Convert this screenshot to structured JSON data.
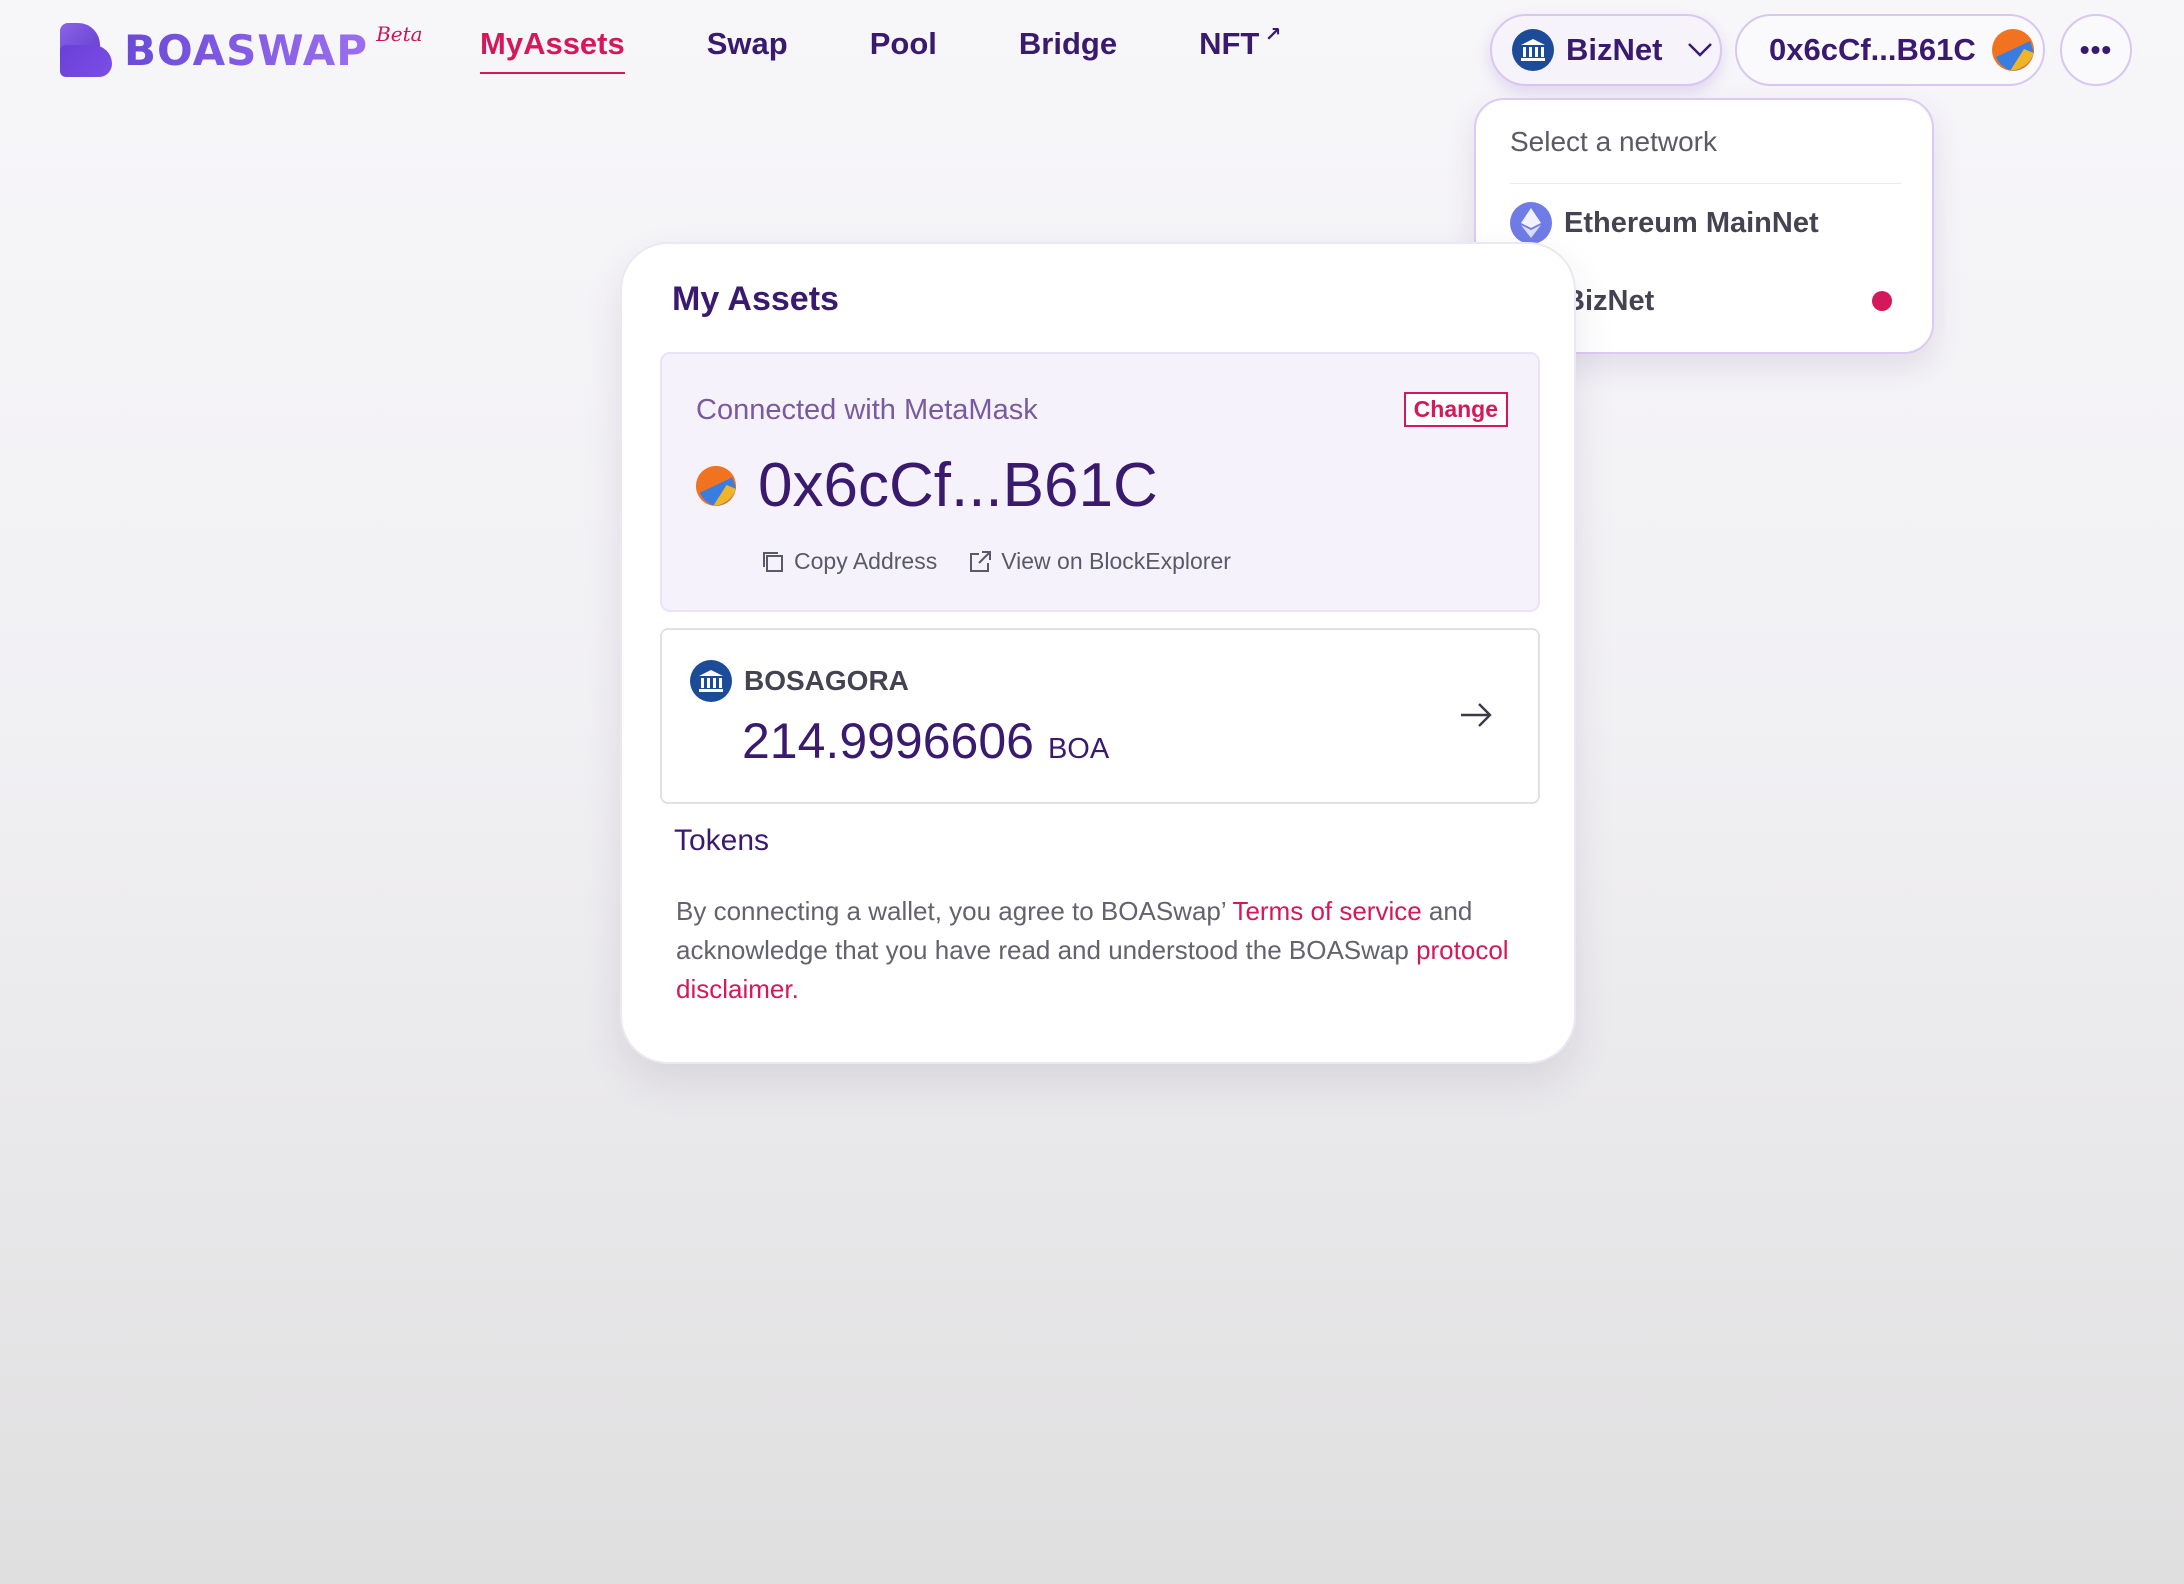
{
  "brand": {
    "name": "BOASWAP",
    "tag": "Beta"
  },
  "nav": {
    "myassets": "MyAssets",
    "swap": "Swap",
    "pool": "Pool",
    "bridge": "Bridge",
    "nft": "NFT",
    "nft_ext": "↗"
  },
  "header": {
    "network_label": "BizNet",
    "address_short": "0x6cCf...B61C",
    "more_label": "•••"
  },
  "network_menu": {
    "title": "Select a network",
    "options": [
      {
        "label": "Ethereum MainNet",
        "icon": "ethereum-icon"
      },
      {
        "label": "BizNet",
        "icon": "bank-icon",
        "selected": true
      }
    ]
  },
  "card": {
    "title": "My Assets",
    "connected_text": "Connected with MetaMask",
    "change_label": "Change",
    "address": "0x6cCf...B61C",
    "copy_label": "Copy Address",
    "explorer_label": "View on BlockExplorer",
    "asset": {
      "name": "BOSAGORA",
      "amount": "214.9996606",
      "unit": "BOA"
    },
    "tokens_label": "Tokens",
    "legal": {
      "part1": "By connecting a wallet, you agree to BOASwap’ ",
      "terms": "Terms of service",
      "part2": " and acknowledge that you have read and understood the BOASwap ",
      "disclaimer": "protocol disclaimer."
    }
  },
  "colors": {
    "accent": "#d4185a",
    "primary_text": "#3a1a6e",
    "biznet_blue": "#1c4b97",
    "eth_purple": "#6f7ce6"
  }
}
